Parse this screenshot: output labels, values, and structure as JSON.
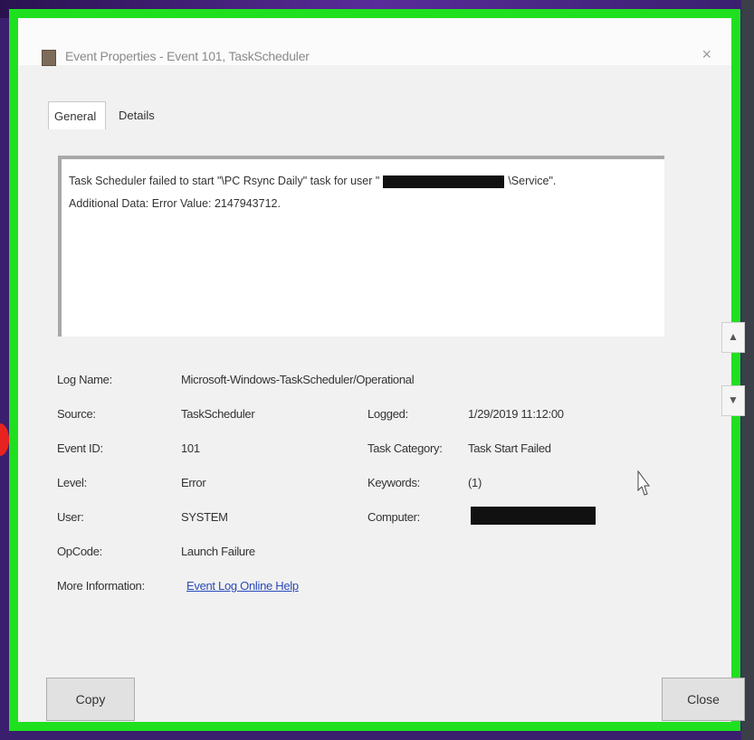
{
  "window": {
    "title": "Event Properties - Event 101, TaskScheduler",
    "close_glyph": "×"
  },
  "tabs": [
    {
      "label": "General",
      "active": true
    },
    {
      "label": "Details",
      "active": false
    }
  ],
  "description": {
    "line1_a": "Task Scheduler failed to start \"\\PC Rsync Daily\" task for user \"",
    "line1_b": "\\Service\".",
    "line2": "Additional Data: Error Value: 2147943712."
  },
  "fields": {
    "log_name_label": "Log Name:",
    "log_name_value": "Microsoft-Windows-TaskScheduler/Operational",
    "source_label": "Source:",
    "source_value": "TaskScheduler",
    "logged_label": "Logged:",
    "logged_value": "1/29/2019 11:12:00",
    "event_id_label": "Event ID:",
    "event_id_value": "101",
    "task_category_label": "Task Category:",
    "task_category_value": "Task Start Failed",
    "level_label": "Level:",
    "level_value": "Error",
    "keywords_label": "Keywords:",
    "keywords_value": "(1)",
    "user_label": "User:",
    "user_value": "SYSTEM",
    "computer_label": "Computer:",
    "opcode_label": "OpCode:",
    "opcode_value": "Launch Failure",
    "more_info_label": "More Information:",
    "more_info_link": "Event Log Online Help"
  },
  "buttons": {
    "copy": "Copy",
    "close": "Close"
  },
  "scroll": {
    "up_glyph": "▲",
    "down_glyph": "▼"
  },
  "colors": {
    "frame": "#1fe01f",
    "link": "#2a4bb8"
  }
}
